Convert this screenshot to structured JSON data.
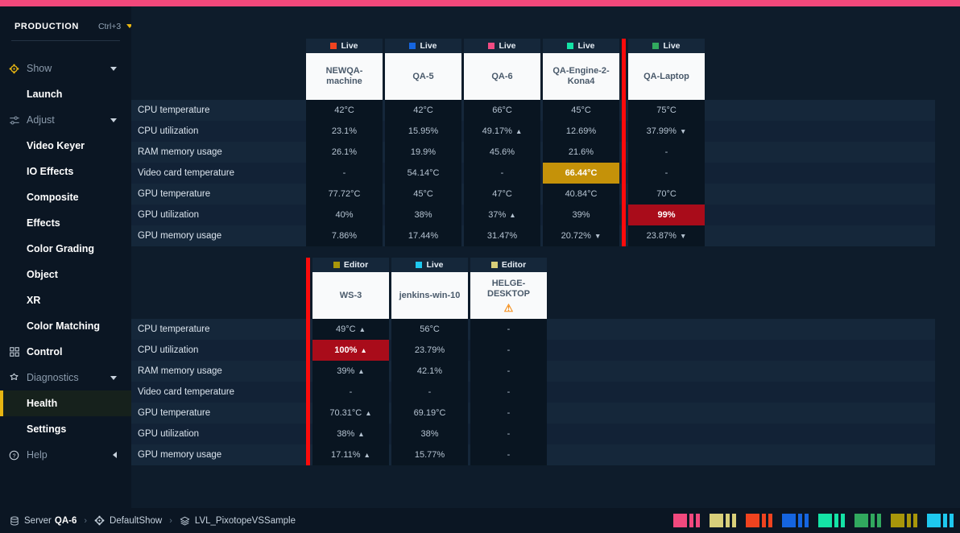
{
  "theme": {
    "accent_pink": "#f2487b",
    "highlight_yellow": "#e8b612",
    "amber_cell": "#c59209",
    "red_cell": "#a90c1a",
    "red_marker": "#fb0b0b",
    "bg": "#0e1c2b",
    "sidebar_bg": "#0b1623"
  },
  "sidebar": {
    "production_label": "PRODUCTION",
    "shortcut": "Ctrl+3",
    "items": [
      {
        "label": "Show",
        "type": "group",
        "icon": "show-icon",
        "icon_color": "#e8b612",
        "caret": "down"
      },
      {
        "label": "Launch",
        "type": "child",
        "active": false
      },
      {
        "label": "Adjust",
        "type": "group",
        "icon": "sliders-icon",
        "icon_color": "#8b9bac",
        "caret": "down"
      },
      {
        "label": "Video Keyer",
        "type": "child",
        "active": false
      },
      {
        "label": "IO Effects",
        "type": "child",
        "active": false
      },
      {
        "label": "Composite",
        "type": "child",
        "active": false
      },
      {
        "label": "Effects",
        "type": "child",
        "active": false
      },
      {
        "label": "Color Grading",
        "type": "child",
        "active": false
      },
      {
        "label": "Object",
        "type": "child",
        "active": false
      },
      {
        "label": "XR",
        "type": "child",
        "active": false
      },
      {
        "label": "Color Matching",
        "type": "child",
        "active": false
      },
      {
        "label": "Control",
        "type": "group",
        "icon": "grid-icon",
        "icon_color": "#c9d3dd",
        "caret": "none",
        "bold": true
      },
      {
        "label": "Diagnostics",
        "type": "group",
        "icon": "diagnostics-icon",
        "icon_color": "#c9d3dd",
        "caret": "down"
      },
      {
        "label": "Health",
        "type": "child",
        "active": true
      },
      {
        "label": "Settings",
        "type": "child",
        "active": false
      },
      {
        "label": "Help",
        "type": "group",
        "icon": "help-icon",
        "icon_color": "#c9d3dd",
        "caret": "left"
      }
    ]
  },
  "health": {
    "metrics": [
      "CPU temperature",
      "CPU utilization",
      "RAM memory usage",
      "Video card temperature",
      "GPU temperature",
      "GPU utilization",
      "GPU memory usage"
    ],
    "tables": [
      {
        "machines": [
          {
            "name": "NEWQA-machine",
            "status": "Live",
            "status_color": "#f0431f",
            "warning": false,
            "selected": false,
            "values": [
              {
                "text": "42°C",
                "state": "normal",
                "trend": "none"
              },
              {
                "text": "23.1%",
                "state": "normal",
                "trend": "none"
              },
              {
                "text": "26.1%",
                "state": "normal",
                "trend": "none"
              },
              {
                "text": "-",
                "state": "normal",
                "trend": "none"
              },
              {
                "text": "77.72°C",
                "state": "normal",
                "trend": "none"
              },
              {
                "text": "40%",
                "state": "normal",
                "trend": "none"
              },
              {
                "text": "7.86%",
                "state": "normal",
                "trend": "none"
              }
            ]
          },
          {
            "name": "QA-5",
            "status": "Live",
            "status_color": "#1565e0",
            "warning": false,
            "selected": false,
            "values": [
              {
                "text": "42°C",
                "state": "normal",
                "trend": "none"
              },
              {
                "text": "15.95%",
                "state": "normal",
                "trend": "none"
              },
              {
                "text": "19.9%",
                "state": "normal",
                "trend": "none"
              },
              {
                "text": "54.14°C",
                "state": "normal",
                "trend": "none"
              },
              {
                "text": "45°C",
                "state": "normal",
                "trend": "none"
              },
              {
                "text": "38%",
                "state": "normal",
                "trend": "none"
              },
              {
                "text": "17.44%",
                "state": "normal",
                "trend": "none"
              }
            ]
          },
          {
            "name": "QA-6",
            "status": "Live",
            "status_color": "#f14b82",
            "warning": false,
            "selected": false,
            "values": [
              {
                "text": "66°C",
                "state": "normal",
                "trend": "none"
              },
              {
                "text": "49.17%",
                "state": "normal",
                "trend": "up"
              },
              {
                "text": "45.6%",
                "state": "normal",
                "trend": "none"
              },
              {
                "text": "-",
                "state": "normal",
                "trend": "none"
              },
              {
                "text": "47°C",
                "state": "normal",
                "trend": "none"
              },
              {
                "text": "37%",
                "state": "normal",
                "trend": "up"
              },
              {
                "text": "31.47%",
                "state": "normal",
                "trend": "none"
              }
            ]
          },
          {
            "name": "QA-Engine-2-Kona4",
            "status": "Live",
            "status_color": "#14e3a6",
            "warning": false,
            "selected": false,
            "values": [
              {
                "text": "45°C",
                "state": "normal",
                "trend": "none"
              },
              {
                "text": "12.69%",
                "state": "normal",
                "trend": "none"
              },
              {
                "text": "21.6%",
                "state": "normal",
                "trend": "none"
              },
              {
                "text": "66.44°C",
                "state": "amber",
                "trend": "none"
              },
              {
                "text": "40.84°C",
                "state": "normal",
                "trend": "none"
              },
              {
                "text": "39%",
                "state": "normal",
                "trend": "none"
              },
              {
                "text": "20.72%",
                "state": "normal",
                "trend": "down"
              }
            ]
          },
          {
            "name": "QA-Laptop",
            "status": "Live",
            "status_color": "#31a95e",
            "warning": false,
            "selected": true,
            "values": [
              {
                "text": "75°C",
                "state": "normal",
                "trend": "none"
              },
              {
                "text": "37.99%",
                "state": "normal",
                "trend": "down"
              },
              {
                "text": "-",
                "state": "normal",
                "trend": "none"
              },
              {
                "text": "-",
                "state": "normal",
                "trend": "none"
              },
              {
                "text": "70°C",
                "state": "normal",
                "trend": "none"
              },
              {
                "text": "99%",
                "state": "red",
                "trend": "none"
              },
              {
                "text": "23.87%",
                "state": "normal",
                "trend": "down"
              }
            ]
          }
        ]
      },
      {
        "machines": [
          {
            "name": "WS-3",
            "status": "Editor",
            "status_color": "#a8960a",
            "warning": false,
            "selected": true,
            "values": [
              {
                "text": "49°C",
                "state": "normal",
                "trend": "up"
              },
              {
                "text": "100%",
                "state": "red",
                "trend": "up"
              },
              {
                "text": "39%",
                "state": "normal",
                "trend": "up"
              },
              {
                "text": "-",
                "state": "normal",
                "trend": "none"
              },
              {
                "text": "70.31°C",
                "state": "normal",
                "trend": "up"
              },
              {
                "text": "38%",
                "state": "normal",
                "trend": "up"
              },
              {
                "text": "17.11%",
                "state": "normal",
                "trend": "up"
              }
            ]
          },
          {
            "name": "jenkins-win-10",
            "status": "Live",
            "status_color": "#1ec8ef",
            "warning": false,
            "selected": false,
            "values": [
              {
                "text": "56°C",
                "state": "normal",
                "trend": "none"
              },
              {
                "text": "23.79%",
                "state": "normal",
                "trend": "none"
              },
              {
                "text": "42.1%",
                "state": "normal",
                "trend": "none"
              },
              {
                "text": "-",
                "state": "normal",
                "trend": "none"
              },
              {
                "text": "69.19°C",
                "state": "normal",
                "trend": "none"
              },
              {
                "text": "38%",
                "state": "normal",
                "trend": "none"
              },
              {
                "text": "15.77%",
                "state": "normal",
                "trend": "none"
              }
            ]
          },
          {
            "name": "HELGE-DESKTOP",
            "status": "Editor",
            "status_color": "#d8cf7a",
            "warning": true,
            "warning_glyph": "⚠",
            "selected": false,
            "values": [
              {
                "text": "-",
                "state": "normal",
                "trend": "none"
              },
              {
                "text": "-",
                "state": "normal",
                "trend": "none"
              },
              {
                "text": "-",
                "state": "normal",
                "trend": "none"
              },
              {
                "text": "-",
                "state": "normal",
                "trend": "none"
              },
              {
                "text": "-",
                "state": "normal",
                "trend": "none"
              },
              {
                "text": "-",
                "state": "normal",
                "trend": "none"
              },
              {
                "text": "-",
                "state": "normal",
                "trend": "none"
              }
            ]
          }
        ]
      }
    ],
    "trend_up_glyph": "▲",
    "trend_down_glyph": "▼"
  },
  "statusbar": {
    "breadcrumbs": [
      {
        "icon": "server-icon",
        "label": "Server",
        "value": "QA-6"
      },
      {
        "icon": "show-icon",
        "label": "DefaultShow",
        "value": ""
      },
      {
        "icon": "layers-icon",
        "label": "LVL_PixotopeVSSample",
        "value": ""
      }
    ],
    "separator": "›",
    "swatches": [
      "#f1497e",
      "#d8cf7a",
      "#f0431f",
      "#1565e0",
      "#14e3a6",
      "#31a95e",
      "#a8960a",
      "#1ec8ef"
    ]
  }
}
